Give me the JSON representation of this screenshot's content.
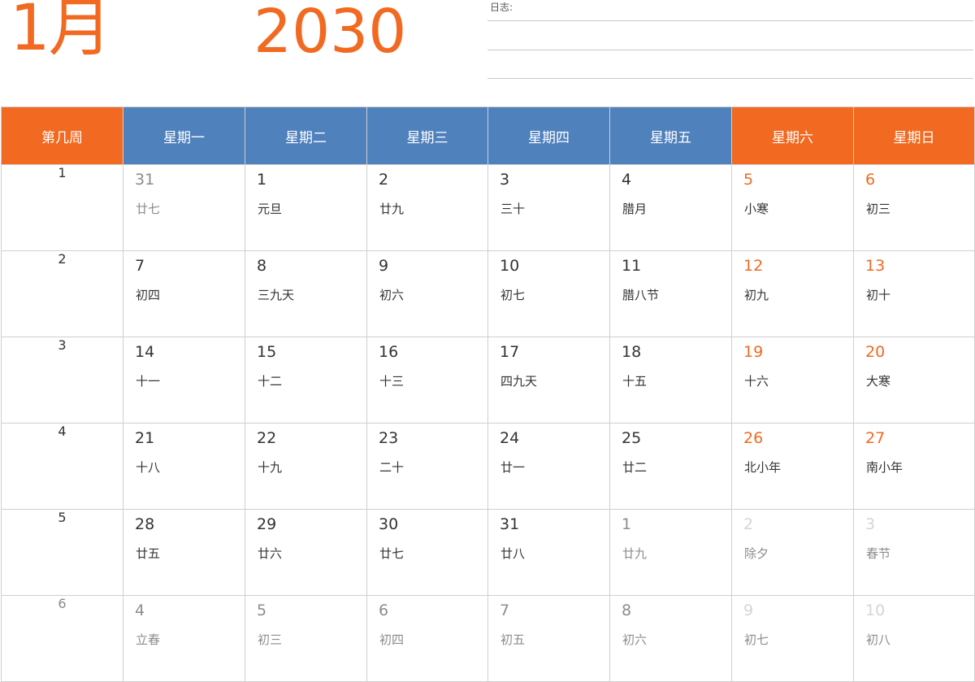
{
  "header": {
    "month": "1月",
    "year": "2030",
    "notes_label": "日志:"
  },
  "colors": {
    "accent": "#f26a21",
    "weekday_header": "#4f81bd"
  },
  "table": {
    "week_header": "第几周",
    "day_headers": [
      "星期一",
      "星期二",
      "星期三",
      "星期四",
      "星期五",
      "星期六",
      "星期日"
    ],
    "weeks": [
      {
        "no": "1",
        "dim": false,
        "days": [
          {
            "d": "31",
            "l": "廿七",
            "s": "other"
          },
          {
            "d": "1",
            "l": "元旦",
            "s": ""
          },
          {
            "d": "2",
            "l": "廿九",
            "s": ""
          },
          {
            "d": "3",
            "l": "三十",
            "s": ""
          },
          {
            "d": "4",
            "l": "腊月",
            "s": ""
          },
          {
            "d": "5",
            "l": "小寒",
            "s": "weekend"
          },
          {
            "d": "6",
            "l": "初三",
            "s": "weekend"
          }
        ]
      },
      {
        "no": "2",
        "dim": false,
        "days": [
          {
            "d": "7",
            "l": "初四",
            "s": ""
          },
          {
            "d": "8",
            "l": "三九天",
            "s": ""
          },
          {
            "d": "9",
            "l": "初六",
            "s": ""
          },
          {
            "d": "10",
            "l": "初七",
            "s": ""
          },
          {
            "d": "11",
            "l": "腊八节",
            "s": ""
          },
          {
            "d": "12",
            "l": "初九",
            "s": "weekend"
          },
          {
            "d": "13",
            "l": "初十",
            "s": "weekend"
          }
        ]
      },
      {
        "no": "3",
        "dim": false,
        "days": [
          {
            "d": "14",
            "l": "十一",
            "s": ""
          },
          {
            "d": "15",
            "l": "十二",
            "s": ""
          },
          {
            "d": "16",
            "l": "十三",
            "s": ""
          },
          {
            "d": "17",
            "l": "四九天",
            "s": ""
          },
          {
            "d": "18",
            "l": "十五",
            "s": ""
          },
          {
            "d": "19",
            "l": "十六",
            "s": "weekend"
          },
          {
            "d": "20",
            "l": "大寒",
            "s": "weekend"
          }
        ]
      },
      {
        "no": "4",
        "dim": false,
        "days": [
          {
            "d": "21",
            "l": "十八",
            "s": ""
          },
          {
            "d": "22",
            "l": "十九",
            "s": ""
          },
          {
            "d": "23",
            "l": "二十",
            "s": ""
          },
          {
            "d": "24",
            "l": "廿一",
            "s": ""
          },
          {
            "d": "25",
            "l": "廿二",
            "s": ""
          },
          {
            "d": "26",
            "l": "北小年",
            "s": "weekend"
          },
          {
            "d": "27",
            "l": "南小年",
            "s": "weekend"
          }
        ]
      },
      {
        "no": "5",
        "dim": false,
        "days": [
          {
            "d": "28",
            "l": "廿五",
            "s": ""
          },
          {
            "d": "29",
            "l": "廿六",
            "s": ""
          },
          {
            "d": "30",
            "l": "廿七",
            "s": ""
          },
          {
            "d": "31",
            "l": "廿八",
            "s": ""
          },
          {
            "d": "1",
            "l": "廿九",
            "s": "other"
          },
          {
            "d": "2",
            "l": "除夕",
            "s": "faint"
          },
          {
            "d": "3",
            "l": "春节",
            "s": "faint"
          }
        ]
      },
      {
        "no": "6",
        "dim": true,
        "days": [
          {
            "d": "4",
            "l": "立春",
            "s": "other"
          },
          {
            "d": "5",
            "l": "初三",
            "s": "other"
          },
          {
            "d": "6",
            "l": "初四",
            "s": "other"
          },
          {
            "d": "7",
            "l": "初五",
            "s": "other"
          },
          {
            "d": "8",
            "l": "初六",
            "s": "other"
          },
          {
            "d": "9",
            "l": "初七",
            "s": "faint"
          },
          {
            "d": "10",
            "l": "初八",
            "s": "faint"
          }
        ]
      }
    ]
  }
}
